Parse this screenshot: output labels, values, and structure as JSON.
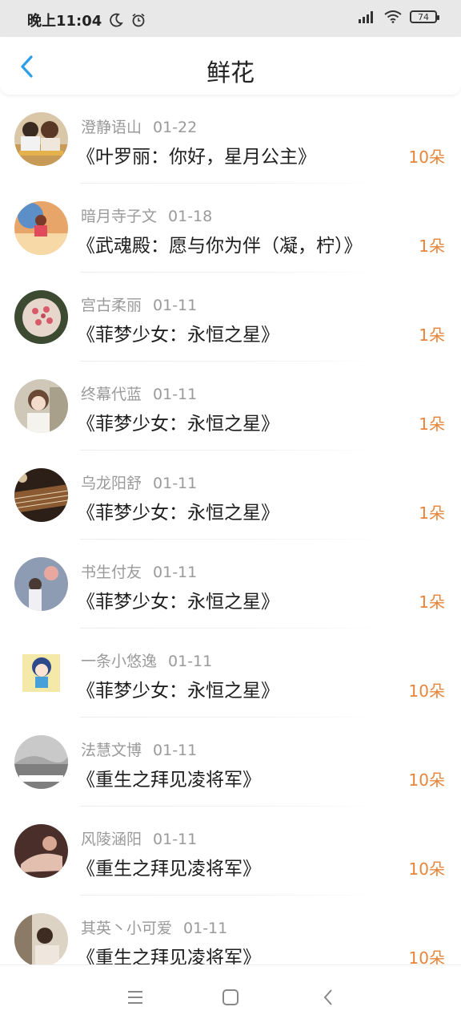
{
  "status_bar": {
    "time": "晚上11:04",
    "battery": "74"
  },
  "header": {
    "title": "鲜花"
  },
  "list": [
    {
      "user": "澄静语山",
      "date": "01-22",
      "book": "《叶罗丽：你好，星月公主》",
      "count": "10朵"
    },
    {
      "user": "暗月寺子文",
      "date": "01-18",
      "book": "《武魂殿：愿与你为伴（凝，柠）》",
      "count": "1朵"
    },
    {
      "user": "宫古柔丽",
      "date": "01-11",
      "book": "《菲梦少女：永恒之星》",
      "count": "1朵"
    },
    {
      "user": "终幕代蓝",
      "date": "01-11",
      "book": "《菲梦少女：永恒之星》",
      "count": "1朵"
    },
    {
      "user": "乌龙阳舒",
      "date": "01-11",
      "book": "《菲梦少女：永恒之星》",
      "count": "1朵"
    },
    {
      "user": "书生付友",
      "date": "01-11",
      "book": "《菲梦少女：永恒之星》",
      "count": "1朵"
    },
    {
      "user": "一条小悠逸",
      "date": "01-11",
      "book": "《菲梦少女：永恒之星》",
      "count": "10朵"
    },
    {
      "user": "法慧文博",
      "date": "01-11",
      "book": "《重生之拜见凌将军》",
      "count": "10朵"
    },
    {
      "user": "风陵涵阳",
      "date": "01-11",
      "book": "《重生之拜见凌将军》",
      "count": "10朵"
    },
    {
      "user": "其英丶小可爱",
      "date": "01-11",
      "book": "《重生之拜见凌将军》",
      "count": "10朵"
    }
  ],
  "colors": {
    "accent": "#2b9fe8",
    "count": "#e8843a",
    "meta": "#9a9a9a"
  }
}
